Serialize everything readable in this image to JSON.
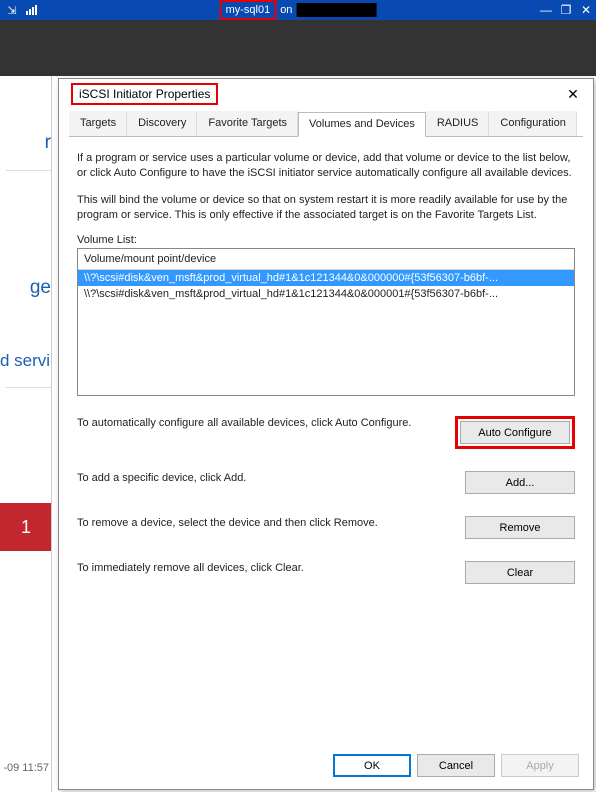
{
  "outer": {
    "hostname": "my-sql01",
    "on_label": "on"
  },
  "left": {
    "frag1": "r",
    "frag2": "ge",
    "frag3": "d service",
    "badge": "1",
    "timestamp": "-09 11:57"
  },
  "dialog": {
    "title": "iSCSI Initiator Properties",
    "tabs": {
      "targets": "Targets",
      "discovery": "Discovery",
      "favorite": "Favorite Targets",
      "volumes": "Volumes and Devices",
      "radius": "RADIUS",
      "configuration": "Configuration"
    },
    "panel": {
      "intro1": "If a program or service uses a particular volume or device, add that volume or device to the list below, or click Auto Configure to have the iSCSI initiator service automatically configure all available devices.",
      "intro2": "This will bind the volume or device so that on system restart it is more readily available for use by the program or service.  This is only effective if the associated target is on the Favorite Targets List.",
      "listLabel": "Volume List:",
      "listHeader": "Volume/mount point/device",
      "items": [
        "\\\\?\\scsi#disk&ven_msft&prod_virtual_hd#1&1c121344&0&000000#{53f56307-b6bf-...",
        "\\\\?\\scsi#disk&ven_msft&prod_virtual_hd#1&1c121344&0&000001#{53f56307-b6bf-..."
      ],
      "auto_text": "To automatically configure all available devices, click Auto Configure.",
      "auto_btn": "Auto Configure",
      "add_text": "To add a specific device, click Add.",
      "add_btn": "Add...",
      "remove_text": "To remove a device, select the device and then click Remove.",
      "remove_btn": "Remove",
      "clear_text": "To immediately remove all devices, click Clear.",
      "clear_btn": "Clear"
    },
    "footer": {
      "ok": "OK",
      "cancel": "Cancel",
      "apply": "Apply"
    }
  }
}
